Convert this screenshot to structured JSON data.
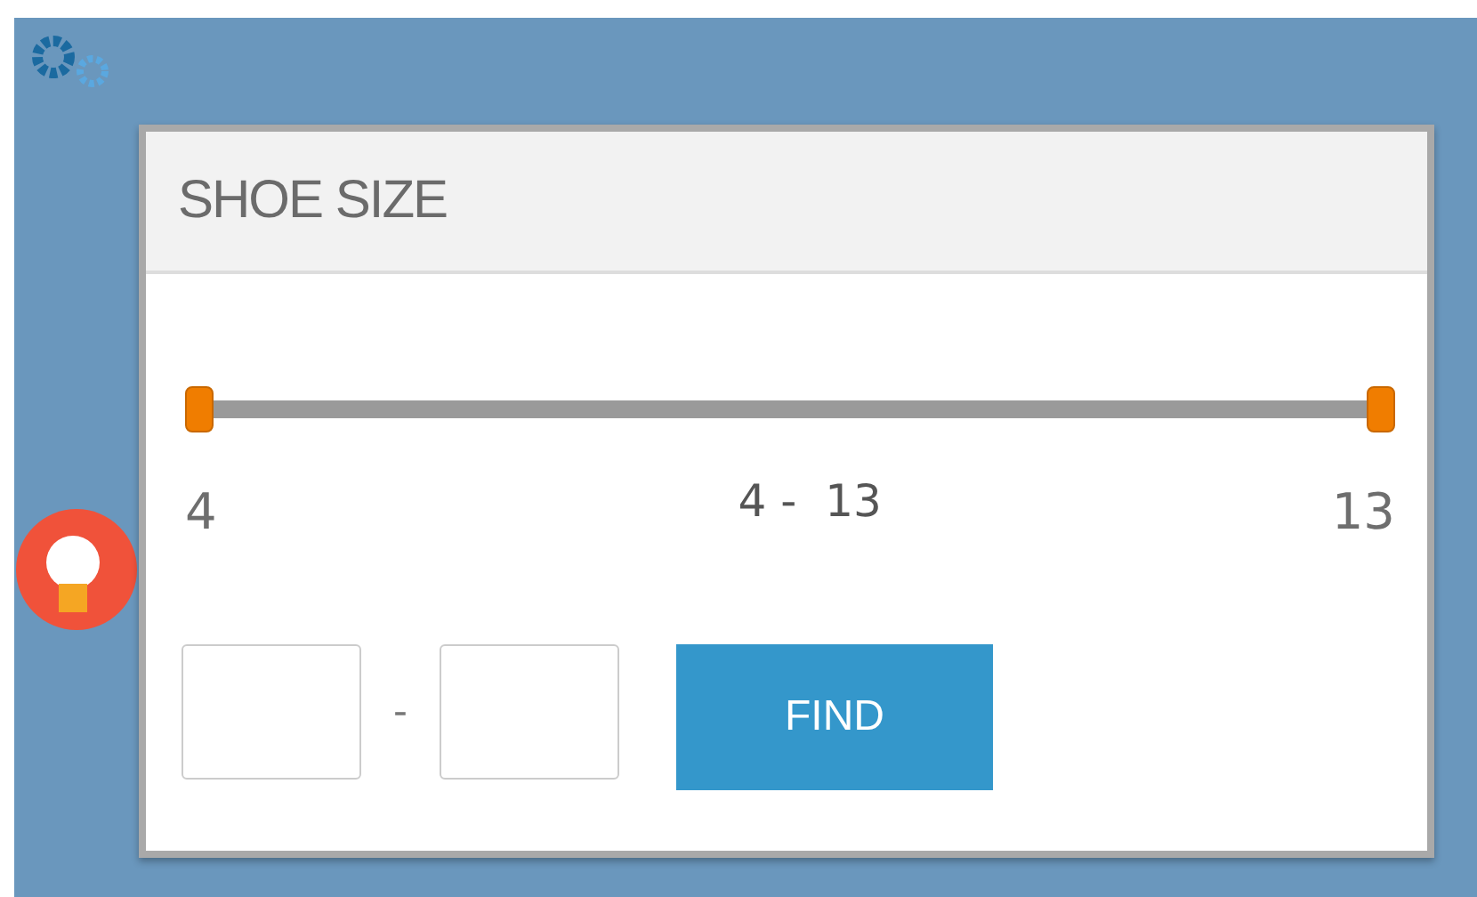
{
  "title": "SHOE SIZE",
  "slider": {
    "min_label": "4",
    "range_label": "4 -  13",
    "max_label": "13",
    "low": {
      "level": 0
    },
    "high": {
      "level": 1
    }
  },
  "range_fields": {
    "separator": "-"
  },
  "button": "FIND"
}
